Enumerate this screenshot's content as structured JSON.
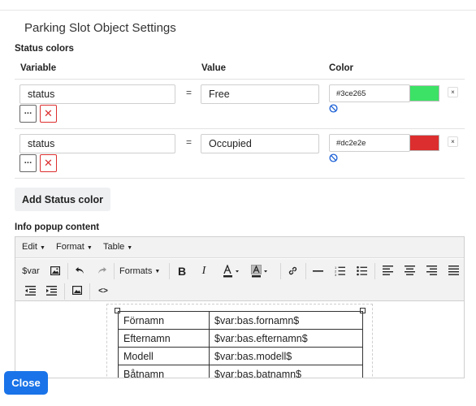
{
  "dialog": {
    "title": "Parking Slot Object Settings"
  },
  "status_colors": {
    "heading": "Status colors",
    "columns": {
      "variable": "Variable",
      "value": "Value",
      "color": "Color"
    },
    "equals": "=",
    "rows": [
      {
        "variable": "status",
        "value": "Free",
        "hex": "#3ce265",
        "swatch": "#3ce265",
        "more": "···",
        "delete": "✕",
        "remove": "×"
      },
      {
        "variable": "status",
        "value": "Occupied",
        "hex": "#dc2e2e",
        "swatch": "#dc2e2e",
        "more": "···",
        "delete": "✕",
        "remove": "×"
      }
    ],
    "add_button": "Add Status color"
  },
  "info_popup": {
    "heading": "Info popup content",
    "menubar": {
      "edit": "Edit",
      "format": "Format",
      "table": "Table"
    },
    "toolbar": {
      "var": "$var",
      "formats": "Formats",
      "bold": "B",
      "italic": "I",
      "code": "<>"
    },
    "icons": [
      "image-icon",
      "undo-icon",
      "redo-icon",
      "text-color-icon",
      "background-color-icon",
      "link-icon",
      "horizontal-rule-icon",
      "numbered-list-icon",
      "bullet-list-icon",
      "align-left-icon",
      "align-center-icon",
      "align-right-icon",
      "align-justify-icon",
      "outdent-icon",
      "indent-icon",
      "media-icon",
      "source-code-icon"
    ],
    "table": [
      [
        "Förnamn",
        "$var:bas.fornamn$"
      ],
      [
        "Efternamn",
        "$var:bas.efternamn$"
      ],
      [
        "Modell",
        "$var:bas.modell$"
      ],
      [
        "Båtnamn",
        "$var:bas.batnamn$"
      ]
    ]
  },
  "footer": {
    "close": "Close"
  },
  "colors": {
    "accent": "#1a73e8",
    "danger": "#dc2e2e",
    "link": "#1a5fd6"
  }
}
